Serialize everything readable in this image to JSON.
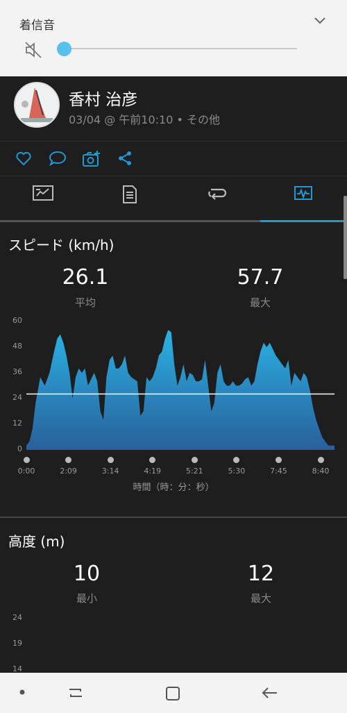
{
  "volume_panel": {
    "title": "着信音",
    "level": 0
  },
  "activity": {
    "user_name": "香村 治彦",
    "meta": "03/04 @ 午前10:10 • その他"
  },
  "speed": {
    "title": "スピード (km/h)",
    "avg_value": "26.1",
    "avg_label": "平均",
    "max_value": "57.7",
    "max_label": "最大",
    "axis_title": "時間（時：分：秒）"
  },
  "altitude": {
    "title": "高度 (m)",
    "min_value": "10",
    "min_label": "最小",
    "max_value": "12",
    "max_label": "最大",
    "yticks": [
      "24",
      "19",
      "14"
    ]
  },
  "colors": {
    "accent": "#1f9ad6",
    "fill_top": "#2bb1e2",
    "fill_bottom": "#2a5f9a"
  },
  "chart_data": {
    "type": "area",
    "x_tick_labels": [
      "0:00",
      "2:09",
      "3:14",
      "4:19",
      "5:21",
      "5:30",
      "7:45",
      "8:40"
    ],
    "y_tick_labels": [
      "60",
      "48",
      "36",
      "24",
      "12",
      "0"
    ],
    "ylim": [
      0,
      60
    ],
    "reference_line": 26.1,
    "x": [
      0,
      0.01,
      0.02,
      0.03,
      0.045,
      0.06,
      0.075,
      0.09,
      0.1,
      0.11,
      0.12,
      0.13,
      0.14,
      0.15,
      0.16,
      0.17,
      0.18,
      0.19,
      0.2,
      0.21,
      0.22,
      0.23,
      0.24,
      0.25,
      0.26,
      0.27,
      0.28,
      0.29,
      0.3,
      0.31,
      0.32,
      0.33,
      0.34,
      0.35,
      0.36,
      0.37,
      0.38,
      0.39,
      0.4,
      0.41,
      0.42,
      0.43,
      0.44,
      0.45,
      0.46,
      0.47,
      0.48,
      0.49,
      0.5,
      0.51,
      0.52,
      0.53,
      0.54,
      0.55,
      0.56,
      0.57,
      0.58,
      0.59,
      0.6,
      0.61,
      0.62,
      0.63,
      0.64,
      0.65,
      0.66,
      0.67,
      0.68,
      0.69,
      0.7,
      0.71,
      0.72,
      0.73,
      0.74,
      0.75,
      0.76,
      0.77,
      0.78,
      0.79,
      0.8,
      0.81,
      0.82,
      0.83,
      0.84,
      0.85,
      0.86,
      0.87,
      0.88,
      0.89,
      0.9,
      0.91,
      0.92,
      0.93,
      0.94,
      0.95,
      0.96,
      0.97,
      0.98,
      0.99,
      1
    ],
    "values": [
      2,
      4,
      10,
      22,
      34,
      30,
      36,
      46,
      52,
      54,
      50,
      44,
      36,
      24,
      34,
      38,
      36,
      38,
      30,
      33,
      36,
      32,
      18,
      14,
      34,
      42,
      44,
      38,
      38,
      40,
      44,
      36,
      34,
      33,
      32,
      16,
      18,
      34,
      32,
      34,
      38,
      44,
      46,
      52,
      56,
      55,
      40,
      30,
      34,
      40,
      32,
      36,
      35,
      32,
      32,
      33,
      42,
      30,
      18,
      22,
      36,
      40,
      32,
      30,
      30,
      32,
      30,
      30,
      31,
      33,
      34,
      30,
      32,
      40,
      46,
      50,
      48,
      50,
      47,
      44,
      42,
      40,
      38,
      42,
      30,
      36,
      34,
      32,
      36,
      34,
      28,
      20,
      14,
      10,
      6,
      4,
      2,
      2,
      2
    ]
  }
}
